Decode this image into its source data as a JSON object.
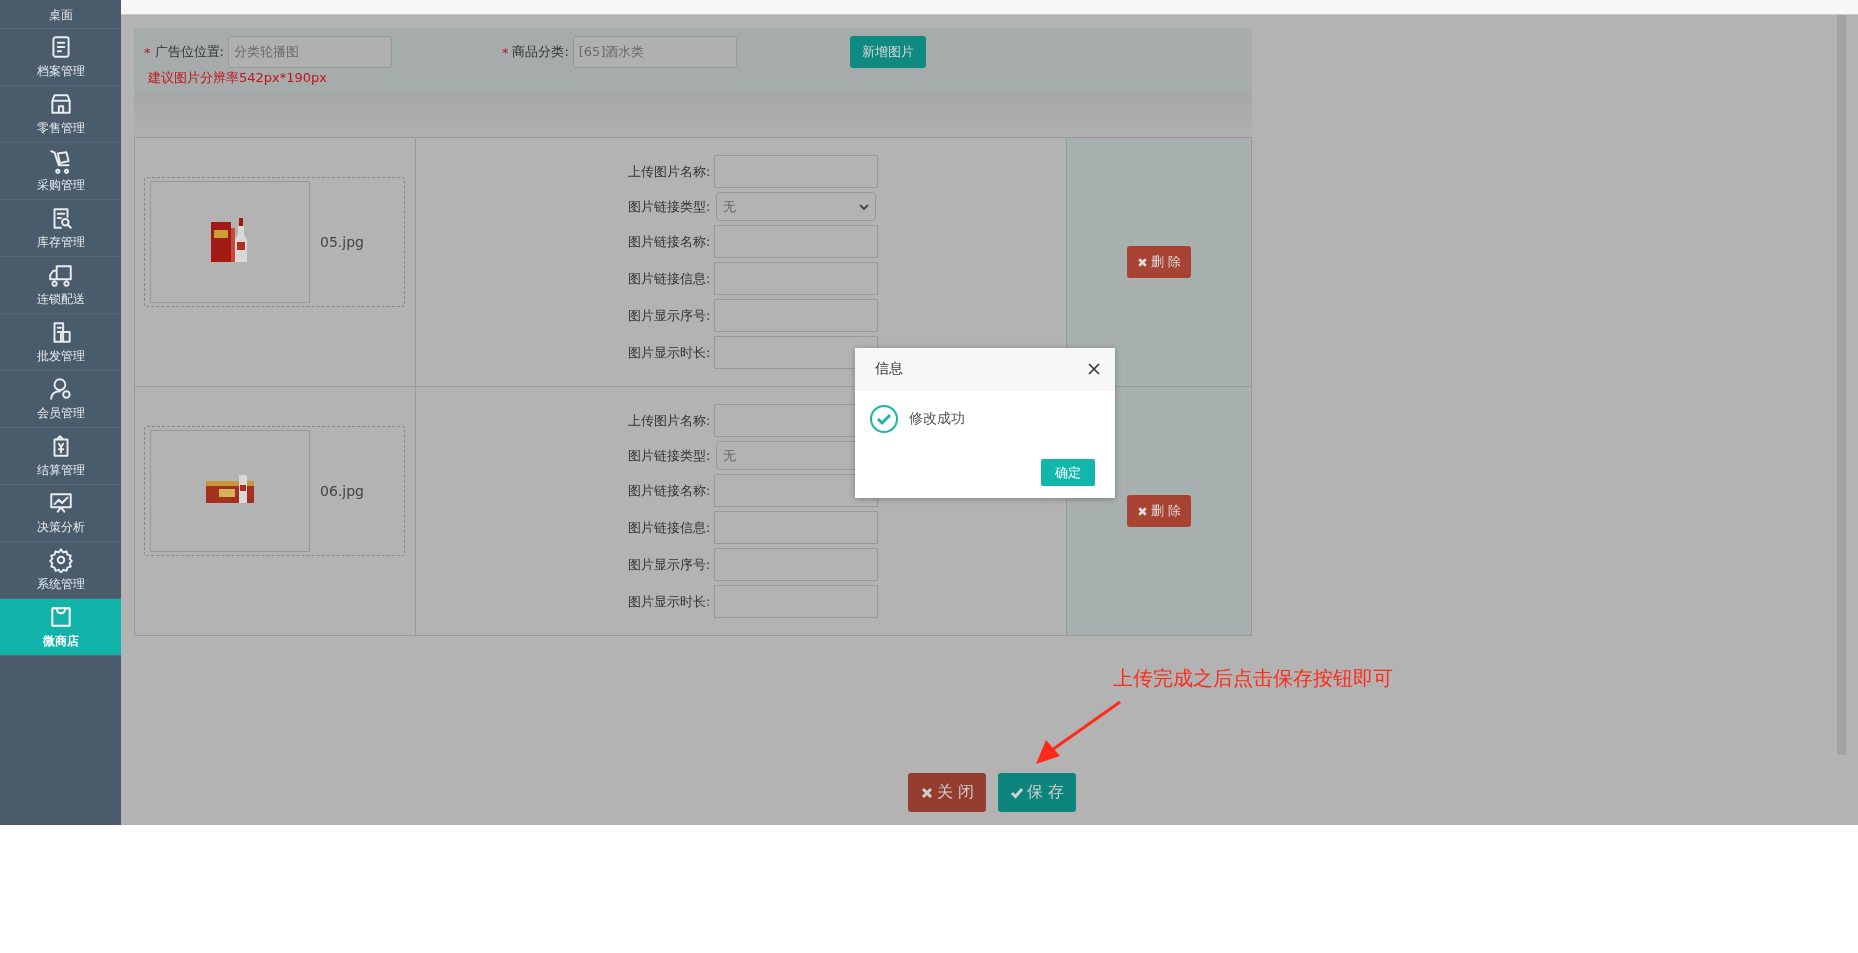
{
  "sidebar": {
    "items": [
      {
        "label": "桌面",
        "selected": false
      },
      {
        "label": "档案管理",
        "selected": false
      },
      {
        "label": "零售管理",
        "selected": false
      },
      {
        "label": "采购管理",
        "selected": false
      },
      {
        "label": "库存管理",
        "selected": false
      },
      {
        "label": "连锁配送",
        "selected": false
      },
      {
        "label": "批发管理",
        "selected": false
      },
      {
        "label": "会员管理",
        "selected": false
      },
      {
        "label": "结算管理",
        "selected": false
      },
      {
        "label": "决策分析",
        "selected": false
      },
      {
        "label": "系统管理",
        "selected": false
      },
      {
        "label": "微商店",
        "selected": true
      }
    ]
  },
  "form": {
    "fields": [
      {
        "mark": "*",
        "label": "广告位位置:",
        "value": "分类轮播图"
      },
      {
        "mark": "*",
        "label": "商品分类:",
        "value": "[65]酒水类"
      }
    ],
    "add_button": "新增图片",
    "hint": "建议图片分辨率542px*190px"
  },
  "images": [
    {
      "filename": "05.jpg",
      "delete_button": "删 除",
      "fields": [
        {
          "kind": "text",
          "label": "上传图片名称:"
        },
        {
          "kind": "select",
          "label": "图片链接类型:",
          "value": "无"
        },
        {
          "kind": "text",
          "label": "图片链接名称:"
        },
        {
          "kind": "text",
          "label": "图片链接信息:"
        },
        {
          "kind": "text",
          "label": "图片显示序号:"
        },
        {
          "kind": "text",
          "label": "图片显示时长:"
        }
      ]
    },
    {
      "filename": "06.jpg",
      "delete_button": "删 除",
      "fields": [
        {
          "kind": "text",
          "label": "上传图片名称:"
        },
        {
          "kind": "select",
          "label": "图片链接类型:",
          "value": "无"
        },
        {
          "kind": "text",
          "label": "图片链接名称:"
        },
        {
          "kind": "text",
          "label": "图片链接信息:"
        },
        {
          "kind": "text",
          "label": "图片显示序号:"
        },
        {
          "kind": "text",
          "label": "图片显示时长:"
        }
      ]
    }
  ],
  "annotation": "上传完成之后点击保存按钮即可",
  "buttons": [
    {
      "kind": "close",
      "label": "关 闭"
    },
    {
      "kind": "save",
      "label": "保 存"
    }
  ],
  "dialog": {
    "title": "信息",
    "message": "修改成功",
    "button": "确定"
  }
}
